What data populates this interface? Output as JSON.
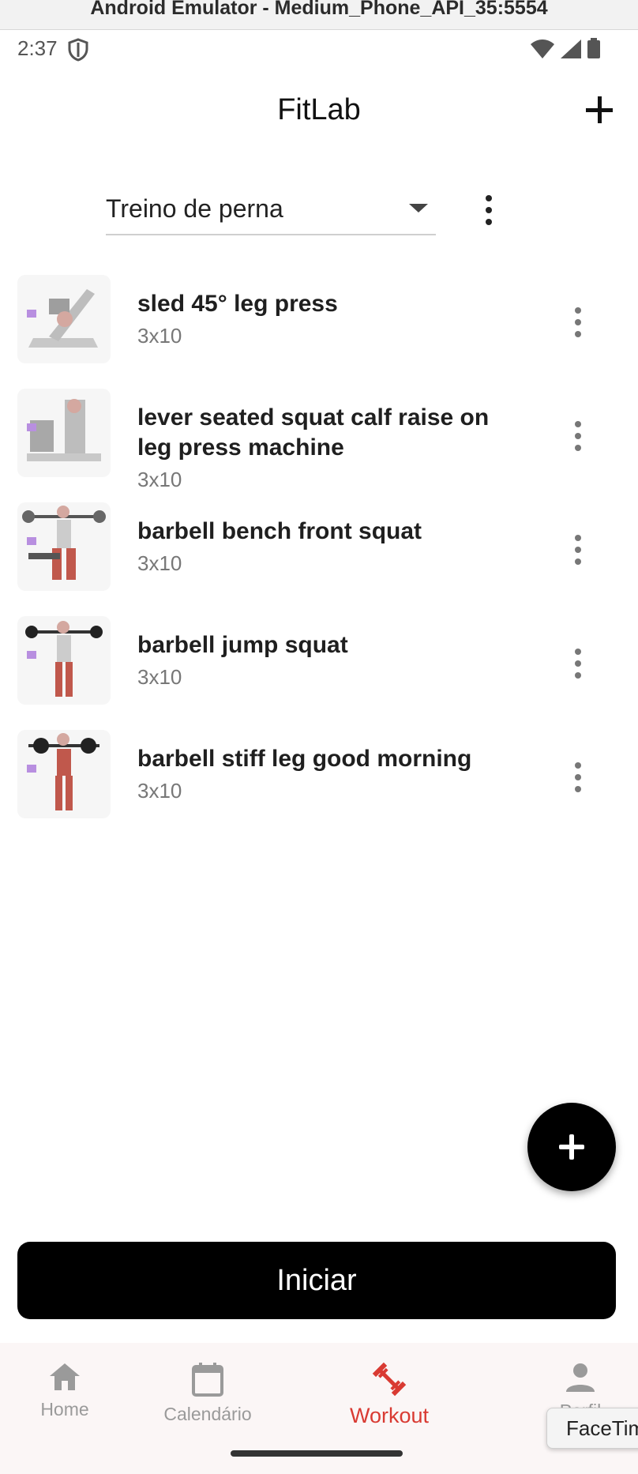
{
  "window": {
    "title": "Android Emulator - Medium_Phone_API_35:5554"
  },
  "status_bar": {
    "time": "2:37"
  },
  "app_bar": {
    "title": "FitLab"
  },
  "workout_selector": {
    "selected": "Treino de perna"
  },
  "exercises": [
    {
      "name": "sled 45° leg press",
      "sets": "3x10"
    },
    {
      "name": "lever seated squat calf raise on leg press machine",
      "sets": "3x10"
    },
    {
      "name": "barbell bench front squat",
      "sets": "3x10"
    },
    {
      "name": "barbell jump squat",
      "sets": "3x10"
    },
    {
      "name": "barbell stiff leg good morning",
      "sets": "3x10"
    }
  ],
  "start_button": {
    "label": "Iniciar"
  },
  "bottom_nav": {
    "items": [
      {
        "label": "Home",
        "icon": "home-icon"
      },
      {
        "label": "Calendário",
        "icon": "calendar-icon"
      },
      {
        "label": "Workout",
        "icon": "dumbbell-icon",
        "active": true
      },
      {
        "label": "Perfil",
        "icon": "person-icon"
      }
    ]
  },
  "overlay": {
    "facetime_label": "FaceTime"
  },
  "colors": {
    "accent": "#d93a32",
    "primary": "#000000",
    "muted_text": "#777777"
  }
}
